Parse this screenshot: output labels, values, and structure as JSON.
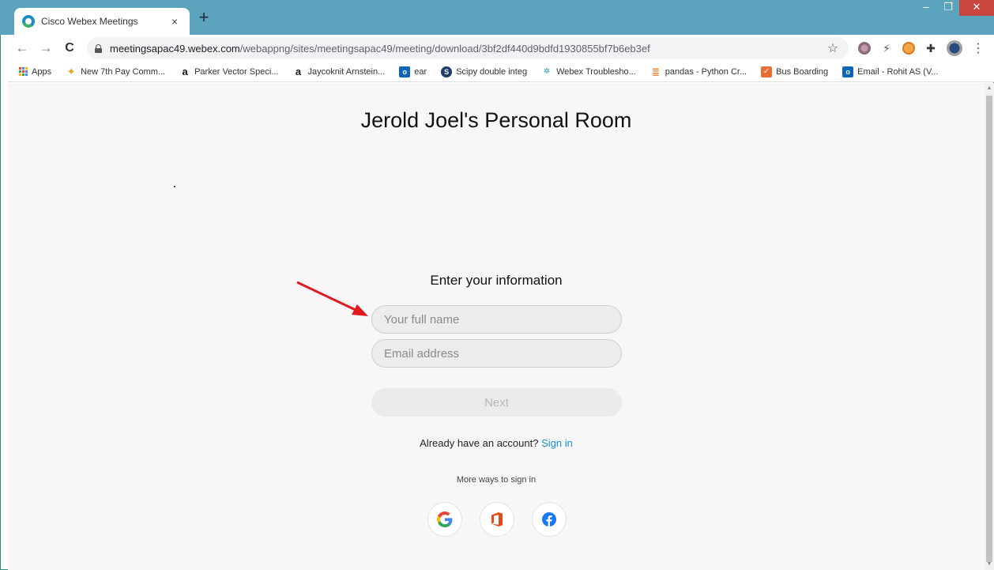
{
  "browser": {
    "tab_title": "Cisco Webex Meetings",
    "tab_close": "×",
    "new_tab": "+",
    "win_minimize": "–",
    "win_restore": "❐",
    "win_close": "✕",
    "nav_back": "←",
    "nav_forward": "→",
    "nav_reload": "C",
    "url_host": "meetingsapac49.webex.com",
    "url_path": "/webappng/sites/meetingsapac49/meeting/download/3bf2df440d9bdfd1930855bf7b6eb3ef",
    "star": "☆",
    "menu": "⋮"
  },
  "bookmarks": [
    {
      "label": "Apps",
      "icon": "apps-grid-icon"
    },
    {
      "label": "New 7th Pay Comm...",
      "icon": "new7-icon",
      "glyph": "✦"
    },
    {
      "label": "Parker Vector Speci...",
      "icon": "amazon-icon",
      "glyph": "a"
    },
    {
      "label": "Jaycoknit Arnstein...",
      "icon": "amazon-icon",
      "glyph": "a"
    },
    {
      "label": "ear",
      "icon": "outlook-icon",
      "glyph": "o"
    },
    {
      "label": "Scipy double integ",
      "icon": "scipy-icon",
      "glyph": "S"
    },
    {
      "label": "Webex Troublesho...",
      "icon": "webex-icon",
      "glyph": "✲"
    },
    {
      "label": "pandas - Python Cr...",
      "icon": "stackoverflow-icon",
      "glyph": "≣"
    },
    {
      "label": "Bus Boarding",
      "icon": "bus-icon",
      "glyph": "✓"
    },
    {
      "label": "Email - Rohit AS (V...",
      "icon": "outlook-icon",
      "glyph": "o"
    }
  ],
  "page": {
    "room_title": "Jerold Joel's Personal Room",
    "form_heading": "Enter your information",
    "name_placeholder": "Your full name",
    "email_placeholder": "Email address",
    "next_label": "Next",
    "account_prompt": "Already have an account?",
    "sign_in_label": "Sign in",
    "more_ways": "More ways to sign in"
  },
  "colors": {
    "titlebar": "#5ca3be",
    "link": "#1a8ed1",
    "arrow": "#e0191e"
  }
}
